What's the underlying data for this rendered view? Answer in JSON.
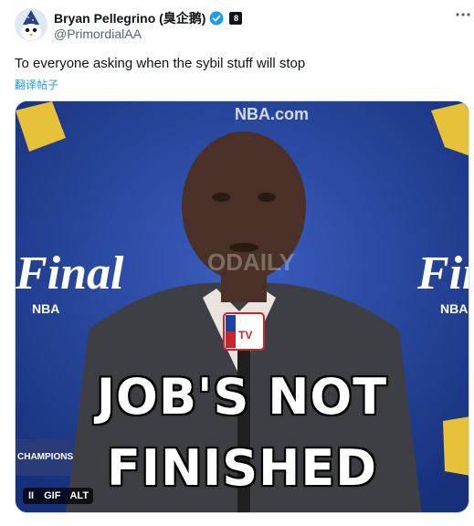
{
  "author": {
    "display_name": "Bryan Pellegrino (臭企鹅)",
    "handle": "@PrimordialAA",
    "affiliate_badge": "8"
  },
  "tweet": {
    "text": "To everyone asking when the sybil stuff will stop",
    "translate_label": "翻译帖子"
  },
  "media": {
    "caption_line1": "JOB'S NOT",
    "caption_line2": "FINISHED",
    "pause_label": "II",
    "gif_label": "GIF",
    "alt_label": "ALT",
    "backdrop_text": {
      "nba_com": "NBA.com",
      "finals_left": "Final",
      "finals_right": "Fina",
      "nba_left": "NBA",
      "nba_right": "NBA",
      "champions": "CHAMPIONS",
      "mic_flag": "TV",
      "watermark": "ODAILY"
    }
  },
  "colors": {
    "backdrop": "#1e3a8a",
    "accent": "#1d9bf0",
    "gold": "#e8c13a"
  }
}
